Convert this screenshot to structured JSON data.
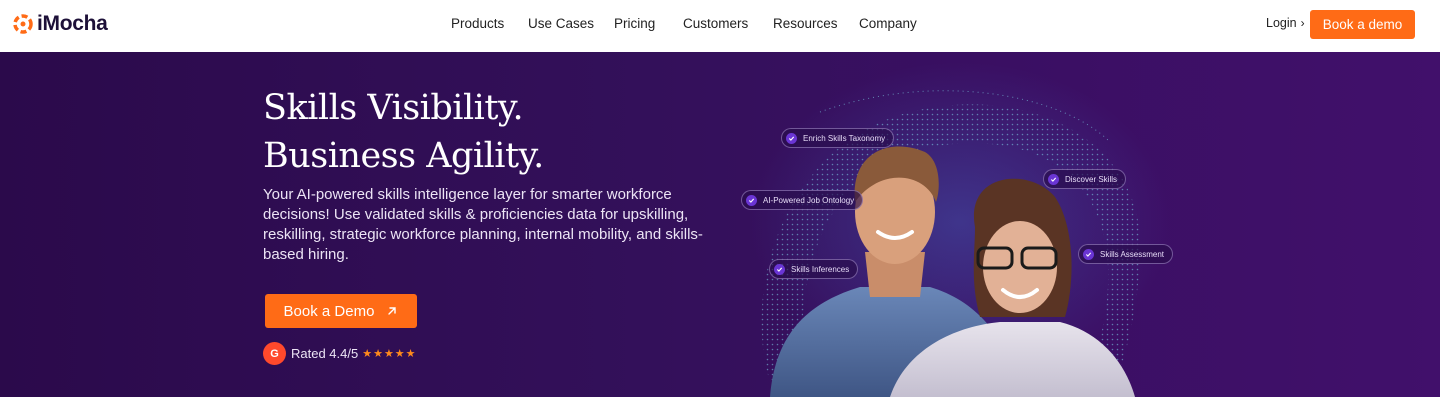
{
  "brand": {
    "name": "iMocha",
    "logo_color": "#ff6b16"
  },
  "nav": {
    "items": [
      "Products",
      "Use Cases",
      "Pricing",
      "Customers",
      "Resources",
      "Company"
    ],
    "login_label": "Login",
    "cta_label": "Book a demo"
  },
  "hero": {
    "headline_line1": "Skills Visibility.",
    "headline_line2": "Business Agility.",
    "subtext": "Your AI-powered skills intelligence layer for smarter workforce decisions! Use validated skills & proficiencies data for upskilling, reskilling, strategic workforce planning, internal mobility, and skills-based hiring.",
    "cta_label": "Book a Demo",
    "rating_badge": "G",
    "rating_text": "Rated 4.4/5",
    "stars": "★★★★★",
    "chips": [
      "Enrich Skills Taxonomy",
      "Discover Skills",
      "AI-Powered Job Ontology",
      "Skills Assessment",
      "Skills Inferences"
    ]
  },
  "colors": {
    "accent": "#ff6b16",
    "hero_bg": "#2b0a4b",
    "chip_check": "#6a35d4",
    "star": "#ff8a1c"
  }
}
